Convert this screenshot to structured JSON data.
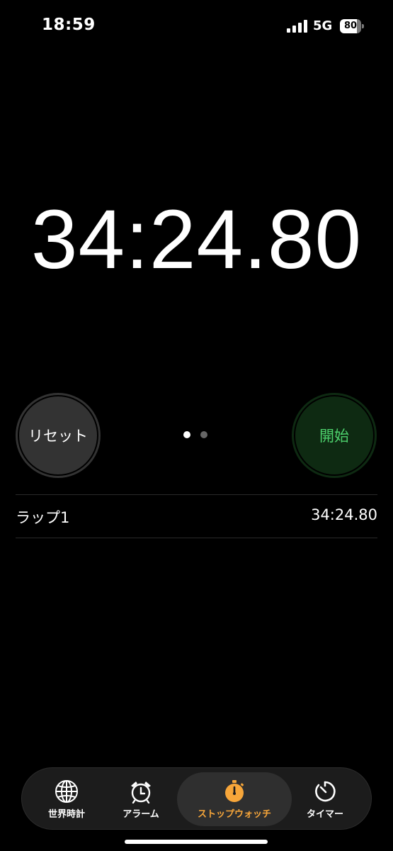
{
  "status_bar": {
    "time": "18:59",
    "network": "5G",
    "battery_level": "80",
    "battery_fraction": 0.8
  },
  "stopwatch": {
    "display": "34:24.80",
    "reset_label": "リセット",
    "start_label": "開始",
    "page_count": 2,
    "active_page": 1,
    "start_color": "#4dd16c"
  },
  "laps": [
    {
      "label": "ラップ1",
      "time": "34:24.80"
    }
  ],
  "tabs": [
    {
      "label": "世界時計",
      "icon": "globe-icon"
    },
    {
      "label": "アラーム",
      "icon": "alarm-clock-icon"
    },
    {
      "label": "ストップウォッチ",
      "icon": "stopwatch-icon",
      "active": true
    },
    {
      "label": "タイマー",
      "icon": "timer-icon"
    }
  ],
  "accent_color": "#f7a63a"
}
